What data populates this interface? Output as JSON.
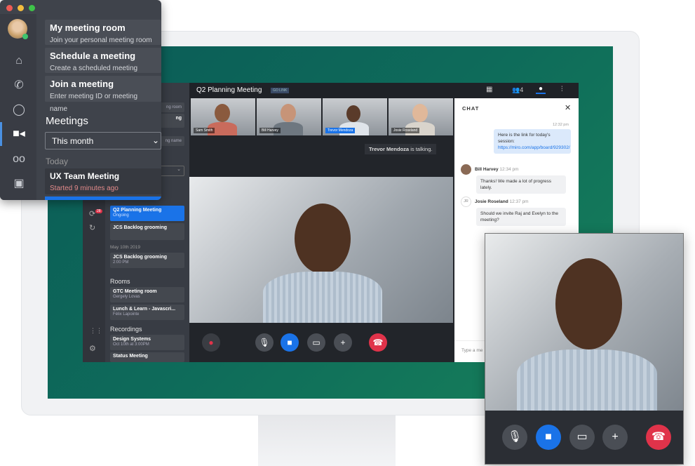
{
  "popup": {
    "items": [
      {
        "title": "My meeting room",
        "subtitle": "Join your personal meeting room"
      },
      {
        "title": "Schedule a meeting",
        "subtitle": "Create a scheduled meeting"
      },
      {
        "title": "Join a meeting",
        "subtitle": "Enter meeting ID or meeting name"
      }
    ],
    "meetings_heading": "Meetings",
    "filter_value": "This month",
    "today_label": "Today",
    "current_meeting": {
      "title": "UX Team Meeting",
      "status": "Started 9 minutes ago"
    },
    "rail_icons": [
      "home-icon",
      "phone-icon",
      "chat-icon",
      "video-icon",
      "voicemail-icon",
      "contacts-icon"
    ]
  },
  "app": {
    "sidebar": {
      "partial_items": [
        "ng room",
        "ng",
        "ng name"
      ],
      "badge_count": "28",
      "meetings": [
        {
          "title": "Q2 Planning Meeting",
          "subtitle": "Ongoing",
          "active": true
        },
        {
          "title": "JCS Backlog grooming",
          "subtitle": ""
        }
      ],
      "date_label": "May 10th 2019",
      "dated_meetings": [
        {
          "title": "JCS Backlog grooming",
          "subtitle": "2:00 PM"
        }
      ],
      "rooms_heading": "Rooms",
      "rooms": [
        {
          "title": "GTC Meeting room",
          "subtitle": "Gergely Lovas"
        },
        {
          "title": "Lunch & Learn - Javascri...",
          "subtitle": "Félix Lapointe"
        }
      ],
      "recordings_heading": "Recordings",
      "recordings": [
        {
          "title": "Design Systems",
          "subtitle": "Oct 10th at 3:00PM"
        },
        {
          "title": "Status Meeting",
          "subtitle": ""
        }
      ]
    },
    "header": {
      "title": "Q2 Planning Meeting",
      "badge": "GO LINK",
      "participant_count": "4"
    },
    "participants": [
      "Sam Smith",
      "Bill Harvey",
      "Trevor Mendoza",
      "Josie Roseland"
    ],
    "talking": {
      "name": "Trevor Mendoza",
      "suffix": " is talking."
    },
    "chat": {
      "title": "CHAT",
      "messages": [
        {
          "time": "12:32 pm",
          "text": "Here is the link for today's session: ",
          "link": "https://miro.com/app/board/929302/"
        },
        {
          "author": "Bill Harvey",
          "time": "12:34 pm",
          "text": "Thanks! We made a lot of progress lately."
        },
        {
          "author": "Josie Roseland",
          "initials": "JR",
          "time": "12:37 pm",
          "text": "Should we invite Raj and Evelyn to the meeting?"
        }
      ],
      "input_placeholder": "Type a me"
    }
  },
  "colors": {
    "accent": "#1a73e8",
    "hangup": "#e0334a",
    "badge": "#e0334a",
    "brand_green": "#0e6b5a"
  }
}
